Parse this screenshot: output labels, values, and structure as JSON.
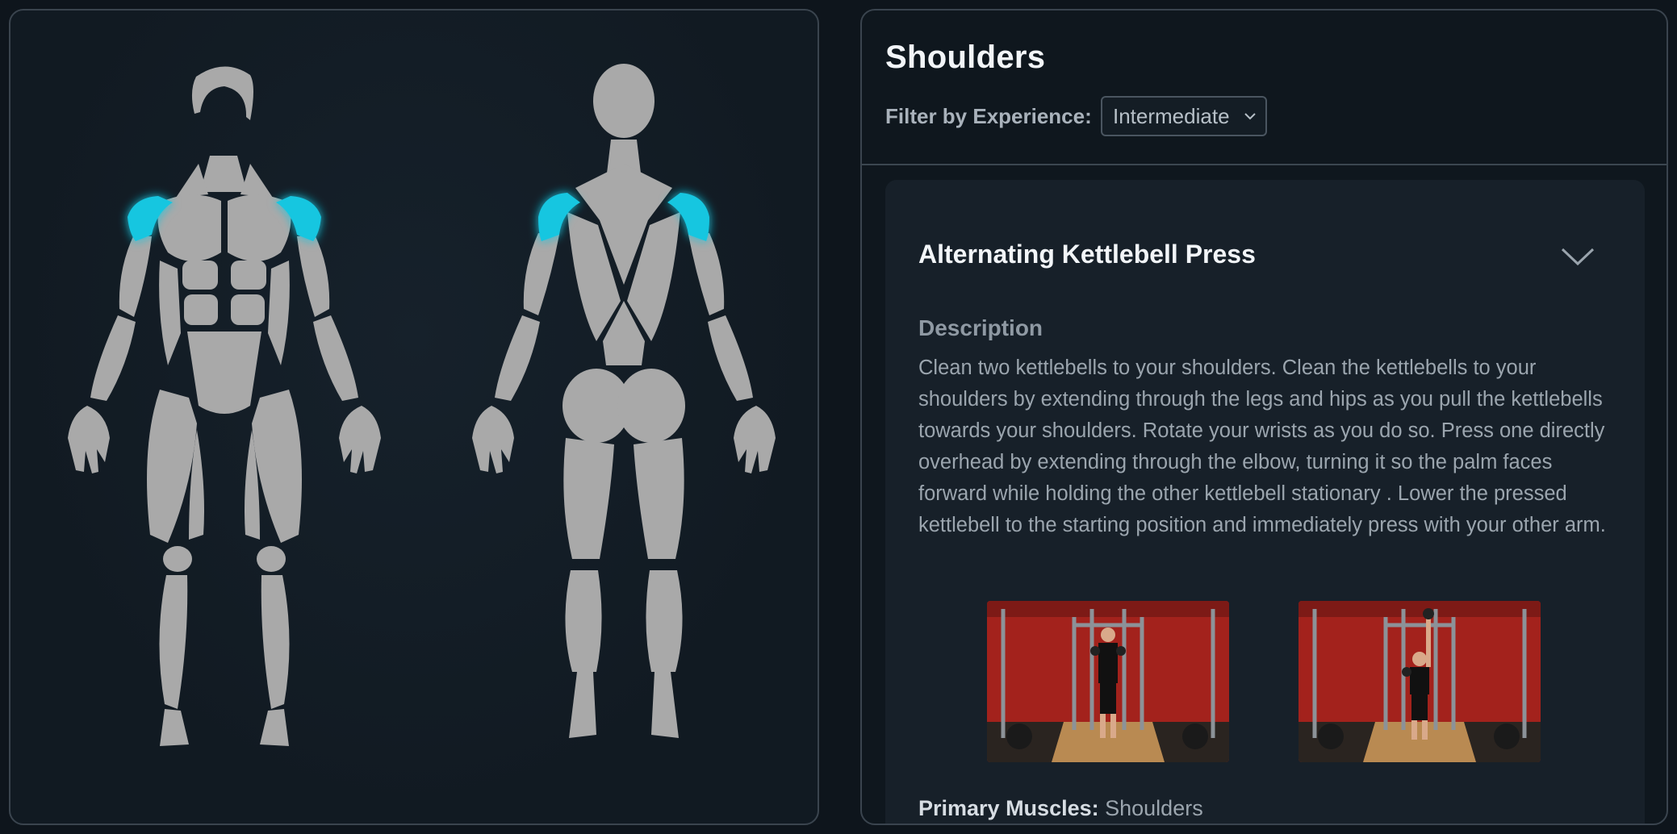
{
  "page": {
    "muscle_title": "Shoulders",
    "filter": {
      "label": "Filter by Experience:",
      "selected": "Intermediate"
    },
    "exercise": {
      "name": "Alternating Kettlebell Press",
      "description_heading": "Description",
      "description": "Clean two kettlebells to your shoulders. Clean the kettlebells to your shoulders by extending through the legs and hips as you pull the kettlebells towards your shoulders. Rotate your wrists as you do so. Press one directly overhead by extending through the elbow, turning it so the palm faces forward while holding the other kettlebell stationary . Lower the pressed kettlebell to the starting position and immediately press with your other arm.",
      "primary_muscles_label": "Primary Muscles:",
      "primary_muscles_value": "Shoulders"
    }
  },
  "icons": {
    "filter_dropdown": "chevron-down-icon",
    "expand": "chevron-down-icon"
  },
  "colors": {
    "highlight_muscle": "#19c6e0",
    "muscle": "#a9a9a9",
    "background": "#0e151c",
    "thumbnail_wall": "#a3221c",
    "thumbnail_floor": "#b98a52"
  },
  "highlighted_muscle_group": "Shoulders"
}
